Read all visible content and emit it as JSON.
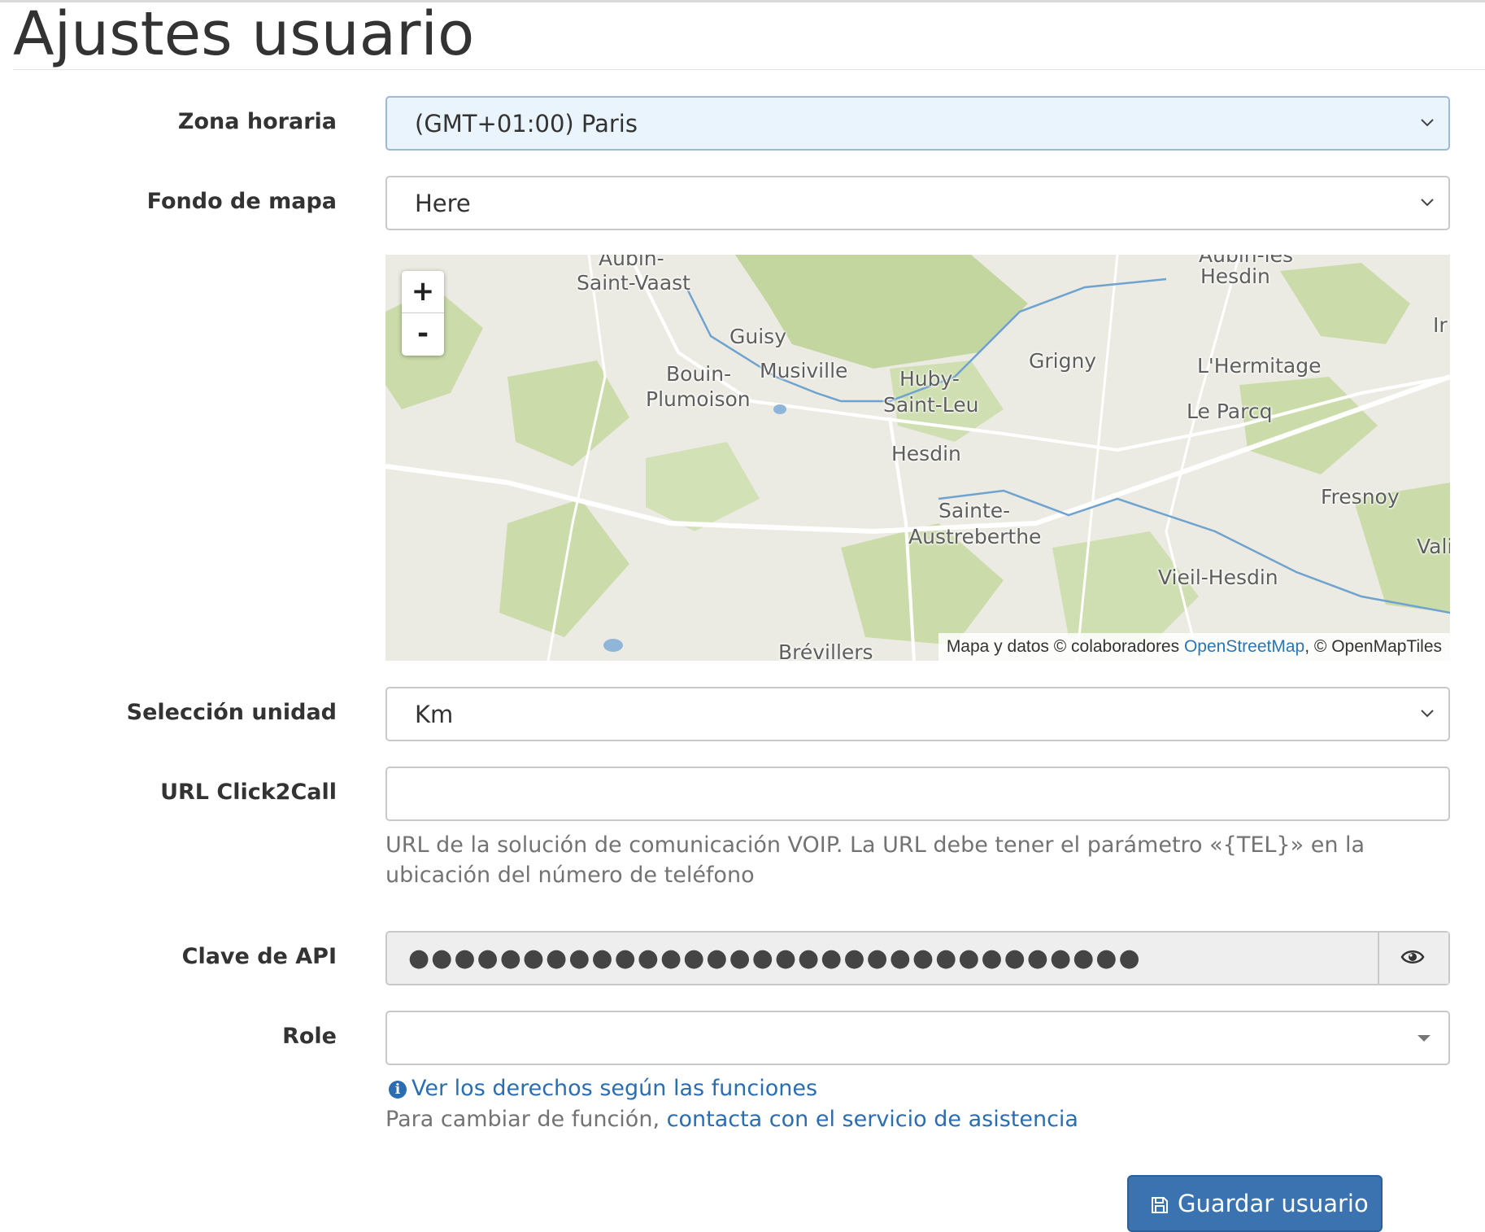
{
  "page": {
    "title": "Ajustes usuario"
  },
  "fields": {
    "timezone": {
      "label": "Zona horaria",
      "value": "(GMT+01:00) Paris"
    },
    "map_background": {
      "label": "Fondo de mapa",
      "value": "Here"
    },
    "unit": {
      "label": "Selección unidad",
      "value": "Km"
    },
    "click2call": {
      "label": "URL Click2Call",
      "value": "",
      "help": "URL de la solución de comunicación VOIP. La URL debe tener el parámetro «{TEL}» en la ubicación del número de teléfono"
    },
    "api_key": {
      "label": "Clave de API",
      "masked_value": "●●●●●●●●●●●●●●●●●●●●●●●●●●●●●●●●"
    },
    "role": {
      "label": "Role",
      "value": "",
      "rights_link": "Ver los derechos según las funciones",
      "change_text": "Para cambiar de función,",
      "support_link": "contacta con el servicio de asistencia"
    }
  },
  "map": {
    "zoom_in": "+",
    "zoom_out": "-",
    "attribution_prefix": "Mapa y datos © colaboradores",
    "attribution_link": "OpenStreetMap",
    "attribution_suffix": ", © OpenMapTiles",
    "places": {
      "aubin": "Aubin-",
      "saint_vaast": "Saint-Vaast",
      "aubin_hesdin_top": "Aubin-les",
      "hesdin_top": "Hesdin",
      "guisy": "Guisy",
      "ir": "Ir",
      "bouin": "Bouin-",
      "plumoison": "Plumoison",
      "musiville": "Musiville",
      "huby": "Huby-",
      "saint_leu": "Saint-Leu",
      "grigny": "Grigny",
      "hermitage": "L'Hermitage",
      "le_parcq": "Le Parcq",
      "hesdin": "Hesdin",
      "sainte": "Sainte-",
      "austreberthe": "Austreberthe",
      "fresnoy": "Fresnoy",
      "vieil_hesdin": "Vieil-Hesdin",
      "vali": "Vali",
      "brevillers": "Brévillers"
    }
  },
  "actions": {
    "save": "Guardar usuario"
  }
}
